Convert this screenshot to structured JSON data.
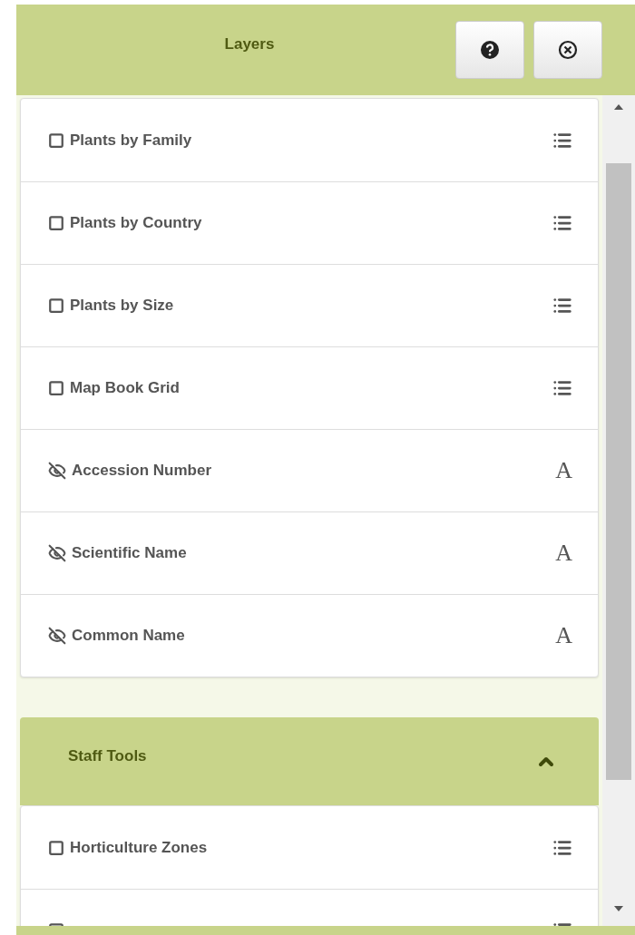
{
  "panel": {
    "title": "Layers",
    "buttons": [
      {
        "kind": "help"
      },
      {
        "kind": "close"
      }
    ]
  },
  "layers": [
    {
      "kind": "layer",
      "label": "Plants by Family",
      "checked": false
    },
    {
      "kind": "layer",
      "label": "Plants by Country",
      "checked": false
    },
    {
      "kind": "layer",
      "label": "Plants by Size",
      "checked": false
    },
    {
      "kind": "layer",
      "label": "Map Book Grid",
      "checked": false
    },
    {
      "kind": "label",
      "label": "Accession Number",
      "visible": false,
      "glyph": "A"
    },
    {
      "kind": "label",
      "label": "Scientific Name",
      "visible": false,
      "glyph": "A"
    },
    {
      "kind": "label",
      "label": "Common Name",
      "visible": false,
      "glyph": "A"
    }
  ],
  "staff_tools": {
    "title": "Staff Tools",
    "expanded": true,
    "items": [
      {
        "kind": "layer",
        "label": "Horticulture Zones",
        "checked": false
      },
      {
        "kind": "layer",
        "checked": false
      }
    ]
  }
}
